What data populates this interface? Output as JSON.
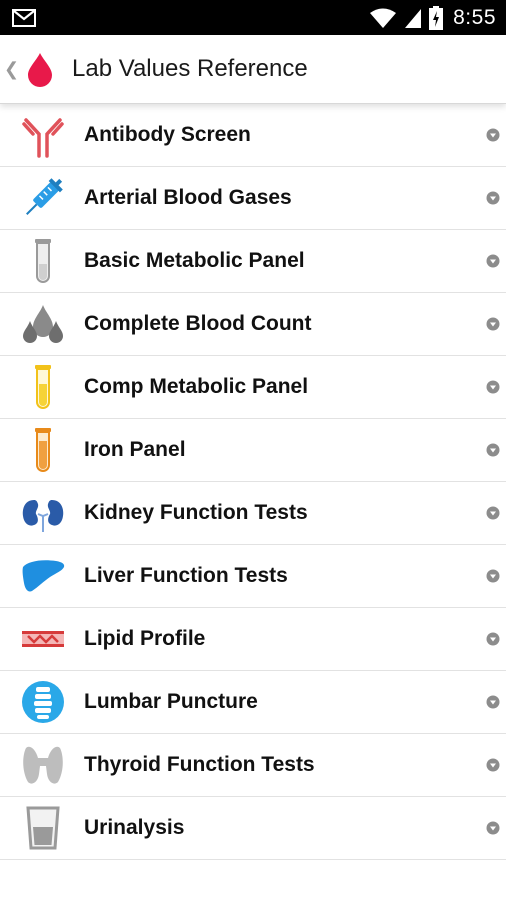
{
  "status": {
    "time": "8:55"
  },
  "header": {
    "title": "Lab Values Reference"
  },
  "colors": {
    "accent": "#e8194a"
  },
  "items": [
    {
      "label": "Antibody Screen",
      "icon": "antibody-icon"
    },
    {
      "label": "Arterial Blood Gases",
      "icon": "syringe-icon"
    },
    {
      "label": "Basic Metabolic Panel",
      "icon": "test-tube-gray-icon"
    },
    {
      "label": "Complete Blood Count",
      "icon": "blood-drops-icon"
    },
    {
      "label": "Comp Metabolic Panel",
      "icon": "test-tube-yellow-icon"
    },
    {
      "label": "Iron Panel",
      "icon": "test-tube-orange-icon"
    },
    {
      "label": "Kidney Function Tests",
      "icon": "kidneys-icon"
    },
    {
      "label": "Liver Function Tests",
      "icon": "liver-icon"
    },
    {
      "label": "Lipid Profile",
      "icon": "artery-icon"
    },
    {
      "label": "Lumbar Puncture",
      "icon": "spine-icon"
    },
    {
      "label": "Thyroid Function Tests",
      "icon": "thyroid-icon"
    },
    {
      "label": "Urinalysis",
      "icon": "cup-icon"
    }
  ]
}
